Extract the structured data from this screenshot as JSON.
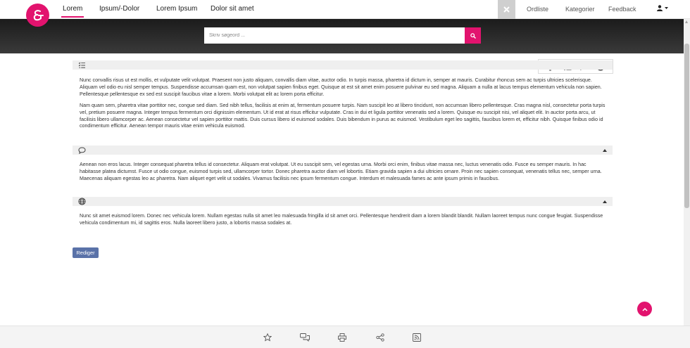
{
  "nav": {
    "tabs": [
      {
        "label": "Lorem",
        "active": true
      },
      {
        "label": "Ipsum/-Dolor"
      },
      {
        "label": "Lorem Ipsum"
      },
      {
        "label": "Dolor sit amet"
      }
    ],
    "right_links": [
      "Ordliste",
      "Kategorier",
      "Feedback"
    ],
    "icons": {
      "close": "close-icon",
      "user": "user-icon"
    }
  },
  "search": {
    "placeholder": "Skriv søgeord ..."
  },
  "tools": [
    "lightbulb-icon",
    "checklist-icon",
    "comment-icon",
    "globe-icon"
  ],
  "sections": [
    {
      "icon": "checklist-icon",
      "paragraphs": [
        "Nunc convallis risus ut est mollis, et vulputate velit volutpat. Praesent non justo aliquam, convallis diam vitae, auctor odio. In turpis massa, pharetra id dictum in, semper at mauris. Curabitur rhoncus sem ac turpis ultricies scelerisque. Aliquam vel odio eu nisl semper tempus. Suspendisse accumsan quam est, non volutpat sapien finibus eget. Quisque at est sit amet enim posuere pulvinar eu sed magna. Aliquam a nulla at lacus tempus elementum vehicula non sapien. Pellentesque pellentesque ex sed est suscipit faucibus vitae a lorem. Morbi volutpat elit ac lorem porta efficitur.",
        "Nam quam sem, pharetra vitae porttitor nec, congue sed diam. Sed nibh tellus, facilisis at enim at, fermentum posuere turpis. Nam suscipit leo at libero tincidunt, non accumsan libero pellentesque. Cras magna nisl, consectetur porta turpis vel, pretium posuere magna. Integer tempus fermentum orci dignissim elementum. Ut id erat at risus efficitur vulputate. Cras in dui et ligula porttitor venenatis sed a lorem. Quisque eu suscipit nisi, vel aliquet elit. In auctor porta arcu, ut facilisis libero ullamcorper ac. Aenean consectetur vel sapien porttitor mattis. Duis cursus libero id euismod sodales. Duis bibendum in purus ac euismod. Vestibulum eget leo sagittis, faucibus lorem et, efficitur nibh. Quisque finibus odio id condimentum efficitur. Aenean tempor mauris vitae enim vehicula euismod."
      ]
    },
    {
      "icon": "comment-icon",
      "paragraphs": [
        "Aenean non eros lacus. Integer consequat pharetra tellus id consectetur. Aliquam erat volutpat. Ut eu suscipit sem, vel egestas urna. Morbi orci enim, finibus vitae massa nec, luctus venenatis odio. Fusce eu semper mauris. In hac habitasse platea dictumst. Fusce ut odio congue, euismod turpis sed, ullamcorper tortor. Donec pharetra auctor diam vel lobortis. Etiam gravida sapien a dui ultricies ornare. Proin nec sapien consequat, venenatis tellus nec, semper urna. Maecenas aliquam egestas leo ac pharetra. Nam aliquet eget velit ut sodales. Vivamus facilisis nec ipsum fermentum congue. Interdum et malesuada fames ac ante ipsum primis in faucibus."
      ]
    },
    {
      "icon": "globe-icon",
      "paragraphs": [
        "Nunc sit amet euismod lorem. Donec nec vehicula lorem. Nullam egestas nulla sit amet leo malesuada fringilla id sit amet orci. Pellentesque hendrerit diam a lorem blandit blandit. Nullam laoreet tempus nunc congue feugiat. Suspendisse vehicula condimentum mi, id sagittis eros. Nulla laoreet libero justo, a lobortis massa sodales at."
      ]
    }
  ],
  "edit_label": "Rediger",
  "bottom_icons": [
    "star-icon",
    "chat-icon",
    "print-icon",
    "share-icon",
    "rss-icon"
  ],
  "colors": {
    "accent": "#e2136e",
    "button": "#5a72a8"
  }
}
